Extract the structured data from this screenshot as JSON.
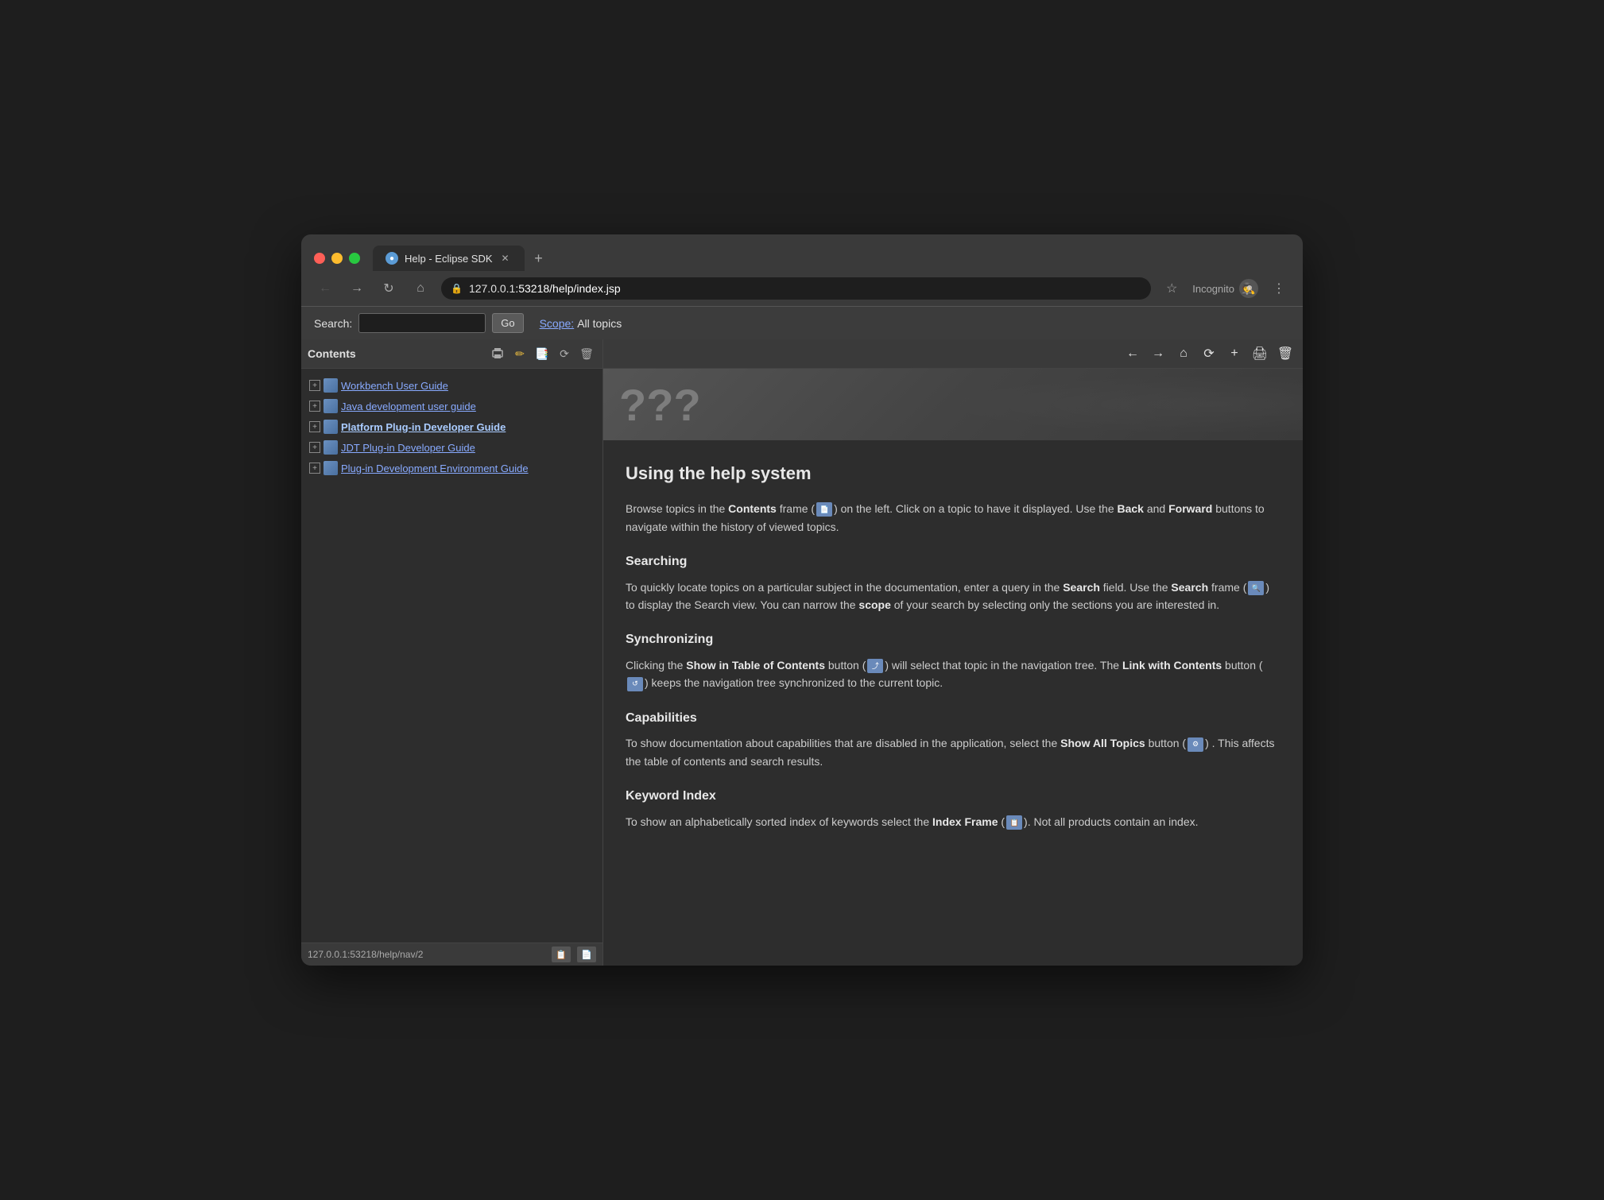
{
  "browser": {
    "tab": {
      "title": "Help - Eclipse SDK",
      "icon_label": "●"
    },
    "address": {
      "prefix": "127.0.0.1",
      "suffix": ":53218/help/index.jsp"
    },
    "incognito_label": "Incognito",
    "nav": {
      "back_label": "←",
      "forward_label": "→",
      "reload_label": "↻",
      "home_label": "⌂"
    }
  },
  "search": {
    "label": "Search:",
    "go_label": "Go",
    "scope_label": "Scope:",
    "scope_value": "All topics"
  },
  "sidebar": {
    "title": "Contents",
    "items": [
      {
        "label": "Workbench User Guide"
      },
      {
        "label": "Java development user guide"
      },
      {
        "label": "Platform Plug-in Developer Guide"
      },
      {
        "label": "JDT Plug-in Developer Guide"
      },
      {
        "label": "Plug-in Development Environment Guide"
      }
    ]
  },
  "toolbar_buttons": {
    "back": "←",
    "forward": "→",
    "home": "⌂",
    "sync": "⟳",
    "add": "+",
    "print": "🖨",
    "delete": "🗑"
  },
  "content": {
    "heading": "Using the help system",
    "intro": "Browse topics in the Contents frame (📄) on the left. Click on a topic to have it displayed. Use the Back and Forward buttons to navigate within the history of viewed topics.",
    "sections": [
      {
        "title": "Searching",
        "body": "To quickly locate topics on a particular subject in the documentation, enter a query in the Search field. Use the Search frame (🔍) to display the Search view. You can narrow the scope of your search by selecting only the sections you are interested in."
      },
      {
        "title": "Synchronizing",
        "body": "Clicking the Show in Table of Contents button (➔) will select that topic in the navigation tree. The Link with Contents button (↺) keeps the navigation tree synchronized to the current topic."
      },
      {
        "title": "Capabilities",
        "body": "To show documentation about capabilities that are disabled in the application, select the Show All Topics button (⚙) . This affects the table of contents and search results."
      },
      {
        "title": "Keyword Index",
        "body": "To show an alphabetically sorted index of keywords select the Index Frame (📋). Not all products contain an index."
      }
    ]
  },
  "status": {
    "url": "127.0.0.1:53218/help/nav/2"
  }
}
